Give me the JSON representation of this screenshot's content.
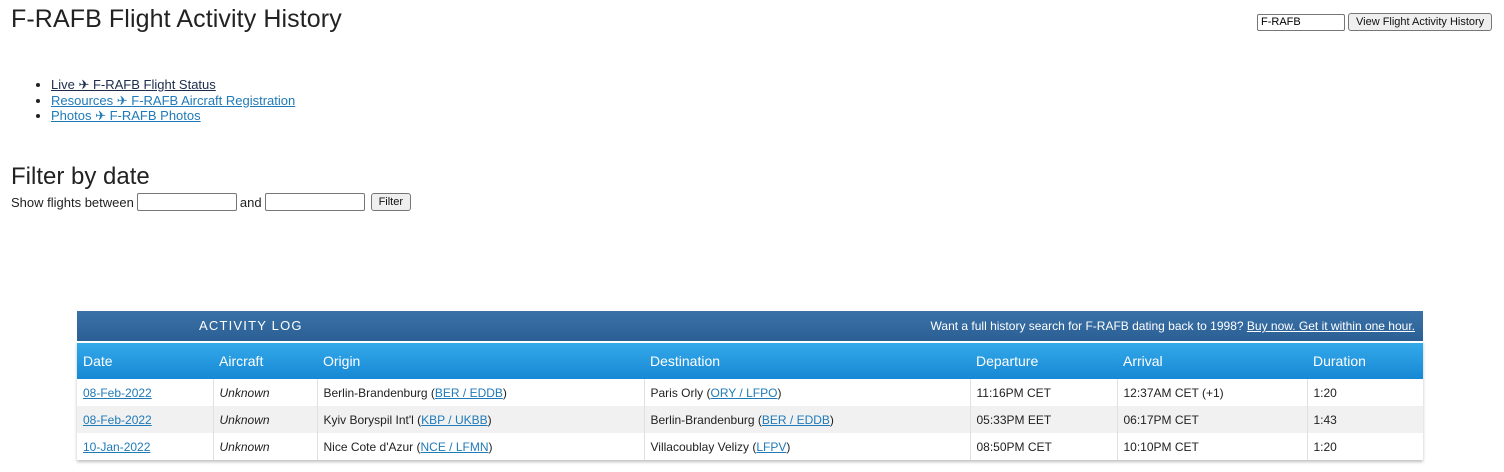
{
  "page": {
    "title": "F-RAFB Flight Activity History"
  },
  "search": {
    "value": "F-RAFB",
    "button_label": "View Flight Activity History"
  },
  "links": [
    {
      "prefix": "Live ✈ ",
      "label": "F-RAFB Flight Status"
    },
    {
      "prefix": "Resources ✈ ",
      "label": "F-RAFB Aircraft Registration"
    },
    {
      "prefix": "Photos ✈ ",
      "label": "F-RAFB Photos"
    }
  ],
  "filter": {
    "title": "Filter by date",
    "label_between": "Show flights between",
    "label_and": "and",
    "from_value": "",
    "to_value": "",
    "button_label": "Filter"
  },
  "activity_log": {
    "title": "ACTIVITY LOG",
    "promo_text": "Want a full history search for F-RAFB dating back to 1998?",
    "promo_link": "Buy now. Get it within one hour.",
    "columns": [
      "Date",
      "Aircraft",
      "Origin",
      "Destination",
      "Departure",
      "Arrival",
      "Duration"
    ],
    "rows": [
      {
        "date": "08-Feb-2022",
        "aircraft": "Unknown",
        "origin_name": "Berlin-Brandenburg",
        "origin_code": "BER / EDDB",
        "dest_name": "Paris Orly",
        "dest_code": "ORY / LFPO",
        "departure": "11:16PM CET",
        "arrival": "12:37AM CET (+1)",
        "duration": "1:20"
      },
      {
        "date": "08-Feb-2022",
        "aircraft": "Unknown",
        "origin_name": "Kyiv Boryspil Int'l",
        "origin_code": "KBP / UKBB",
        "dest_name": "Berlin-Brandenburg",
        "dest_code": "BER / EDDB",
        "departure": "05:33PM EET",
        "arrival": "06:17PM CET",
        "duration": "1:43"
      },
      {
        "date": "10-Jan-2022",
        "aircraft": "Unknown",
        "origin_name": "Nice Cote d'Azur",
        "origin_code": "NCE / LFMN",
        "dest_name": "Villacoublay Velizy",
        "dest_code": "LFPV",
        "departure": "08:50PM CET",
        "arrival": "10:10PM CET",
        "duration": "1:20"
      }
    ]
  }
}
